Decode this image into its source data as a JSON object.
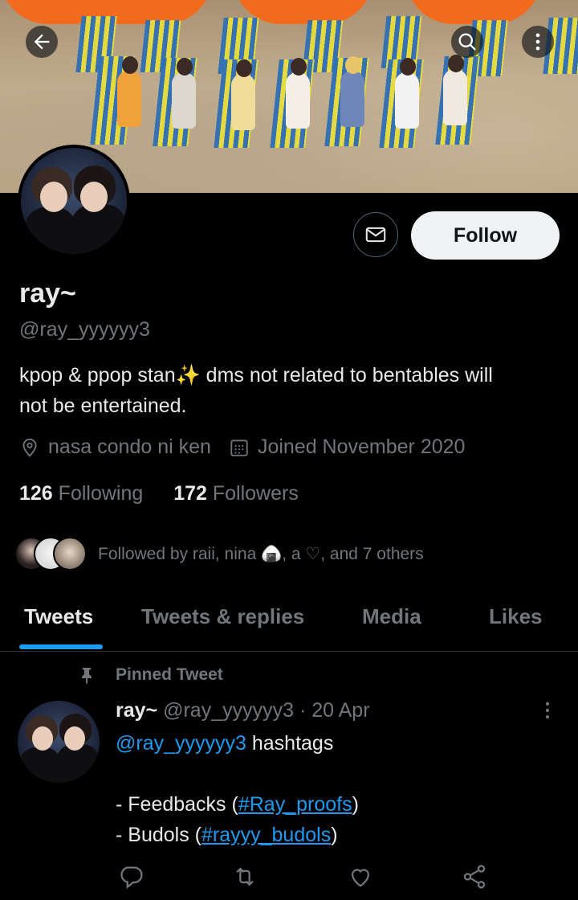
{
  "banner": {
    "back_icon": "arrow-left-icon",
    "search_icon": "search-icon",
    "more_icon": "more-vertical-icon"
  },
  "profile": {
    "name": "ray~",
    "handle": "@ray_yyyyyy3",
    "bio_line1": "kpop & ppop stan",
    "bio_emoji": "✨",
    "bio_line1_rest": " dms not related to bentables will",
    "bio_line2": "not be entertained.",
    "location": "nasa condo ni ken",
    "joined": "Joined November 2020",
    "following_count": "126",
    "following_label": "Following",
    "followers_count": "172",
    "followers_label": "Followers",
    "followed_by": "Followed by raii, nina 🍙, a ♡, and 7 others"
  },
  "actions": {
    "message_icon": "envelope-icon",
    "follow_label": "Follow"
  },
  "tabs": [
    {
      "label": "Tweets",
      "active": true
    },
    {
      "label": "Tweets & replies",
      "active": false
    },
    {
      "label": "Media",
      "active": false
    },
    {
      "label": "Likes",
      "active": false
    }
  ],
  "tweet": {
    "pinned_label": "Pinned Tweet",
    "author_name": "ray~",
    "author_handle": "@ray_yyyyyy3",
    "separator": "·",
    "date": "20 Apr",
    "mention": "@ray_yyyyyy3",
    "text_after_mention": " hashtags",
    "line_feedbacks_prefix": "- Feedbacks (",
    "hashtag_feedbacks": "#Ray_proofs",
    "line_feedbacks_suffix": ")",
    "line_budols_prefix": "- Budols (",
    "hashtag_budols": "#rayyy_budols",
    "line_budols_suffix": ")"
  },
  "colors": {
    "background": "#000000",
    "accent": "#1d9bf0",
    "text_primary": "#e7e9ea",
    "text_secondary": "#71767b",
    "follow_bg": "#eff3f4",
    "umbrella": "#f26b1d"
  }
}
